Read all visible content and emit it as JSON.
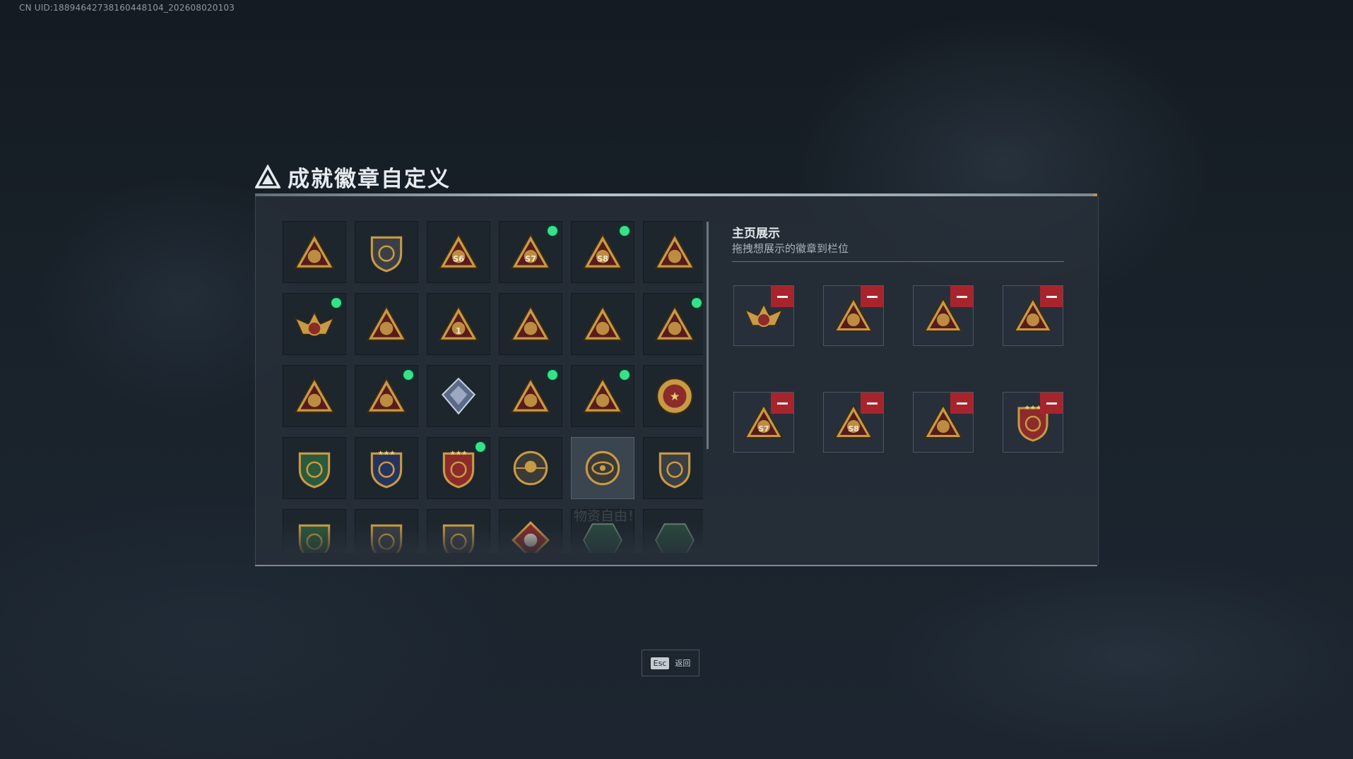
{
  "uid_text": "CN UID:1889464273816044​8104_202608020103",
  "header": {
    "title": "成就徽章自定义",
    "logo_icon": "delta-triangle-logo-icon"
  },
  "grid": {
    "badges": [
      {
        "icon": "shield-triangle-badge-icon",
        "dot": false
      },
      {
        "icon": "helicopter-shield-badge-icon",
        "dot": false
      },
      {
        "icon": "s6-triangle-badge-icon",
        "label": "S6",
        "dot": false
      },
      {
        "icon": "s7-triangle-badge-icon",
        "label": "S7",
        "dot": true
      },
      {
        "icon": "s8-triangle-badge-icon",
        "label": "S8",
        "dot": true
      },
      {
        "icon": "gold-machine-triangle-badge-icon",
        "dot": false
      },
      {
        "icon": "eagle-crest-badge-icon",
        "dot": true
      },
      {
        "icon": "orb-triangle-badge-icon",
        "dot": false
      },
      {
        "icon": "number-one-triangle-badge-icon",
        "label": "1",
        "dot": false
      },
      {
        "icon": "bottle-triangle-badge-icon",
        "dot": false
      },
      {
        "icon": "soldier-triangle-badge-icon",
        "dot": false
      },
      {
        "icon": "emblem-triangle-badge-icon",
        "dot": true
      },
      {
        "icon": "beast-triangle-badge-icon",
        "dot": false
      },
      {
        "icon": "rocket-triangle-badge-icon",
        "dot": true
      },
      {
        "icon": "crystal-cube-badge-icon",
        "dot": false
      },
      {
        "icon": "dragon-triangle-badge-icon",
        "dot": true
      },
      {
        "icon": "operator-triangle-badge-icon",
        "dot": true
      },
      {
        "icon": "star-medal-badge-icon",
        "dot": false
      },
      {
        "icon": "green-shield-badge-icon",
        "dot": false
      },
      {
        "icon": "blue-star-shield-badge-icon",
        "dot": false
      },
      {
        "icon": "red-star-shield-badge-icon",
        "dot": true
      },
      {
        "icon": "skull-target-badge-icon",
        "dot": false
      },
      {
        "icon": "eye-badge-icon",
        "dot": false,
        "selected": true
      },
      {
        "icon": "sniper-shield-badge-icon",
        "dot": false
      },
      {
        "icon": "green-rifle-shield-badge-icon",
        "dot": false
      },
      {
        "icon": "dark-rifle-shield-badge-icon",
        "dot": false
      },
      {
        "icon": "cross-weapons-shield-badge-icon",
        "dot": false
      },
      {
        "icon": "wolf-diamond-badge-icon",
        "dot": false
      },
      {
        "icon": "green-hex-badge-icon",
        "dot": false
      },
      {
        "icon": "green-hex-badge-icon",
        "dot": false
      }
    ],
    "ghost_text": "物资自由！"
  },
  "showcase": {
    "title": "主页展示",
    "subtitle": "拖拽想展示的徽章到栏位",
    "slots": [
      {
        "icon": "eagle-crest-badge-icon"
      },
      {
        "icon": "dragon-triangle-badge-icon"
      },
      {
        "icon": "emblem-triangle-badge-icon"
      },
      {
        "icon": "operator-triangle-badge-icon"
      },
      {
        "icon": "s7-triangle-badge-icon",
        "label": "S7"
      },
      {
        "icon": "s8-triangle-badge-icon",
        "label": "S8"
      },
      {
        "icon": "rocket-triangle-badge-icon"
      },
      {
        "icon": "red-star-shield-badge-icon"
      }
    ],
    "remove_icon": "minus-icon"
  },
  "footer": {
    "esc_key": "Esc",
    "esc_label": "返回"
  },
  "colors": {
    "accent_green": "#37e08a",
    "remove_red": "#a8242d",
    "gold": "#c79a45"
  }
}
